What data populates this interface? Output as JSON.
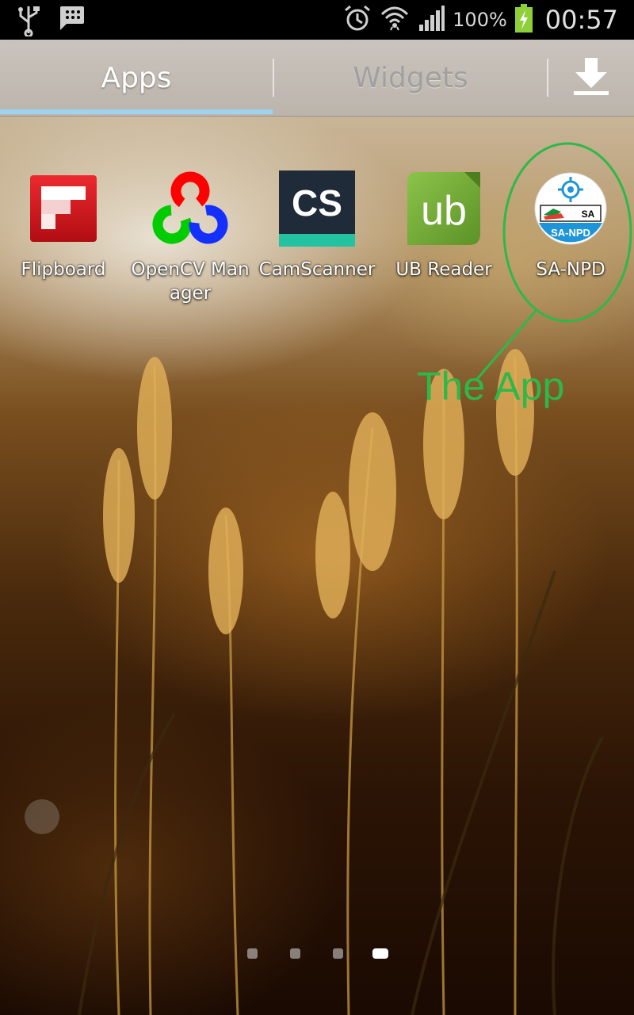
{
  "status_bar": {
    "battery_text": "100%",
    "clock": "00:57",
    "icons": [
      "usb-icon",
      "bbm-icon",
      "alarm-icon",
      "wifi-icon",
      "signal-icon",
      "battery-charging-icon"
    ]
  },
  "tabs": {
    "apps_label": "Apps",
    "widgets_label": "Widgets",
    "active": "Apps",
    "download_icon": "download-icon"
  },
  "apps": [
    {
      "label": "Flipboard"
    },
    {
      "label": "OpenCV Manager"
    },
    {
      "label": "CamScanner"
    },
    {
      "label": "UB Reader"
    },
    {
      "label": "SA-NPD"
    }
  ],
  "icon_text": {
    "camscanner": "CS",
    "ubreader": "ub",
    "sanpd_badge": "SA",
    "sanpd_bottom": "SA-NPD"
  },
  "annotation": {
    "text": "The App",
    "color": "#2db84a"
  },
  "pager": {
    "pages": 4,
    "current": 4
  },
  "colors": {
    "tab_indicator": "#9fd3f0",
    "annotation": "#2db84a"
  }
}
